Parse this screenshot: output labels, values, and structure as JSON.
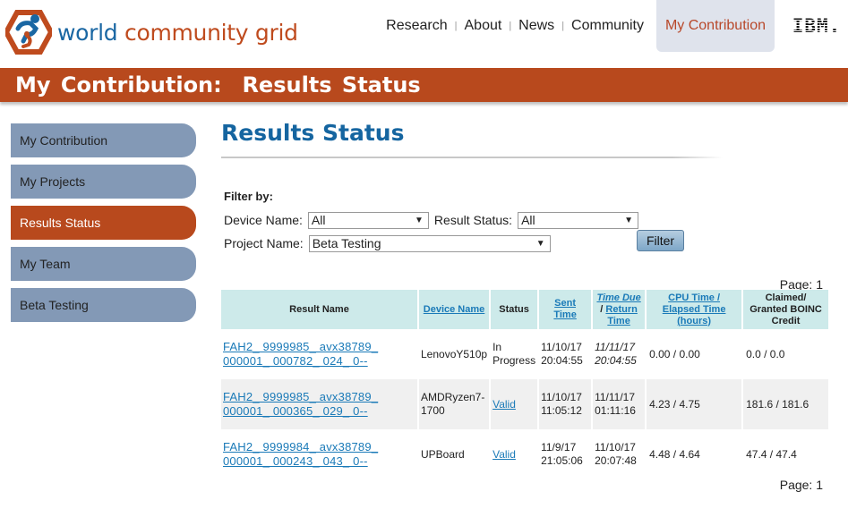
{
  "header": {
    "logo": {
      "word1": "world",
      "word2": "community grid",
      "icon": "wcg-hexagon-logo"
    },
    "nav": [
      {
        "label": "Research",
        "active": false
      },
      {
        "label": "About",
        "active": false
      },
      {
        "label": "News",
        "active": false
      },
      {
        "label": "Community",
        "active": false
      },
      {
        "label": "My Contribution",
        "active": true
      }
    ],
    "nav_separator": "|",
    "partner_logo": "IBM."
  },
  "banner": {
    "title": "My Contribution:  Results Status"
  },
  "sidebar": {
    "items": [
      {
        "label": "My Contribution",
        "active": false
      },
      {
        "label": "My Projects",
        "active": false
      },
      {
        "label": "Results Status",
        "active": true
      },
      {
        "label": "My Team",
        "active": false
      },
      {
        "label": "Beta Testing",
        "active": false
      }
    ]
  },
  "main": {
    "title": "Results Status",
    "filter": {
      "heading": "Filter by:",
      "device_label": "Device Name:",
      "device_value": "All",
      "status_label": "Result Status:",
      "status_value": "All",
      "project_label": "Project Name:",
      "project_value": "Beta Testing",
      "button": "Filter"
    },
    "page_indicator_top": "Page: 1",
    "page_indicator_bottom": "Page: 1",
    "table": {
      "headers": {
        "result_name": "Result Name",
        "device_name": "Device Name",
        "status": "Status",
        "sent_time": "Sent Time",
        "time_due": "Time Due",
        "slash": "/",
        "return_time": "Return Time",
        "cpu_time": "CPU Time / Elapsed Time (hours)",
        "credit": "Claimed/ Granted BOINC Credit"
      },
      "rows": [
        {
          "result_name": "FAH2_ 9999985_ avx38789_ 000001_ 000782_ 024_ 0--",
          "device": "LenovoY510p",
          "status": "In Progress",
          "status_link": false,
          "sent_date": "11/10/17",
          "sent_time": "20:04:55",
          "return_date": "11/11/17",
          "return_time": "20:04:55",
          "return_italic": true,
          "cpu_elapsed": "0.00 / 0.00",
          "credit": "0.0 / 0.0"
        },
        {
          "result_name": "FAH2_ 9999985_ avx38789_ 000001_ 000365_ 029_ 0--",
          "device": "AMDRyzen7-1700",
          "status": "Valid",
          "status_link": true,
          "sent_date": "11/10/17",
          "sent_time": "11:05:12",
          "return_date": "11/11/17",
          "return_time": "01:11:16",
          "return_italic": false,
          "cpu_elapsed": "4.23 / 4.75",
          "credit": "181.6 / 181.6"
        },
        {
          "result_name": "FAH2_ 9999984_ avx38789_ 000001_ 000243_ 043_ 0--",
          "device": "UPBoard",
          "status": "Valid",
          "status_link": true,
          "sent_date": "11/9/17",
          "sent_time": "21:05:06",
          "return_date": "11/10/17",
          "return_time": "20:07:48",
          "return_italic": false,
          "cpu_elapsed": "4.48 / 4.64",
          "credit": "47.4 / 47.4"
        }
      ]
    }
  },
  "colors": {
    "brand_orange": "#b8491d",
    "brand_blue": "#1565a0",
    "sidebar_inactive": "#8399b6",
    "table_header": "#cdeaea",
    "link": "#1a7ab8"
  }
}
